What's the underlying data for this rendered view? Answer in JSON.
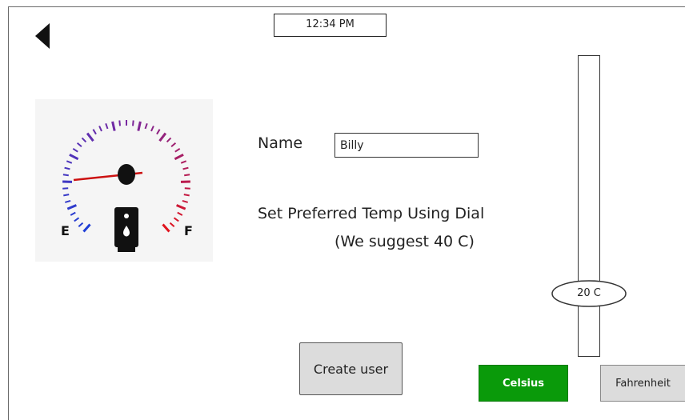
{
  "header": {
    "time": "12:34 PM"
  },
  "gauge": {
    "empty_label": "E",
    "full_label": "F",
    "icon": "fuel-pump-icon"
  },
  "form": {
    "name_label": "Name",
    "name_value": "Billy",
    "instruction": "Set Preferred Temp Using Dial",
    "suggestion": "(We suggest 40 C)"
  },
  "slider": {
    "value_label": "20 C"
  },
  "buttons": {
    "create_user": "Create user",
    "celsius": "Celsius",
    "fahrenheit": "Fahrenheit"
  },
  "colors": {
    "celsius_active": "#0a9a0a",
    "inactive_button": "#dcdcdc",
    "gauge_cold": "#1f3fd6",
    "gauge_hot": "#e0141e",
    "needle": "#cc1111"
  }
}
